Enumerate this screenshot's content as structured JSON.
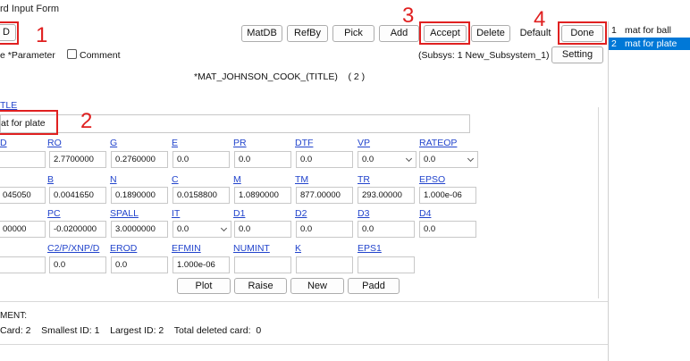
{
  "window": {
    "title": "rd Input Form"
  },
  "toolbar": {
    "id_button": "D",
    "matdb": "MatDB",
    "refby": "RefBy",
    "pick": "Pick",
    "add": "Add",
    "accept": "Accept",
    "delete": "Delete",
    "default": "Default",
    "done": "Done",
    "setting": "Setting"
  },
  "options": {
    "parameter_label": "e *Parameter",
    "comment_label": "Comment",
    "subsys": "(Subsys: 1 New_Subsystem_1)"
  },
  "keyword_title": "*MAT_JOHNSON_COOK_(TITLE)    ( 2 )",
  "title_field": {
    "label": "TLE",
    "value": "at for plate"
  },
  "annotations": [
    "1",
    "2",
    "3",
    "4"
  ],
  "rows": [
    {
      "labels": [
        "D",
        "RO",
        "G",
        "E",
        "PR",
        "DTF",
        "VP",
        "RATEOP"
      ],
      "values": [
        "",
        "2.7700000",
        "0.2760000",
        "0.0",
        "0.0",
        "0.0",
        "0.0",
        "0.0"
      ]
    },
    {
      "labels": [
        "",
        "B",
        "N",
        "C",
        "M",
        "TM",
        "TR",
        "EPSO"
      ],
      "values": [
        "045050",
        "0.0041650",
        "0.1890000",
        "0.0158800",
        "1.0890000",
        "877.00000",
        "293.00000",
        "1.000e-06"
      ]
    },
    {
      "labels": [
        "",
        "PC",
        "SPALL",
        "IT",
        "D1",
        "D2",
        "D3",
        "D4"
      ],
      "values": [
        "00000",
        "-0.0200000",
        "3.0000000",
        "0.0",
        "0.0",
        "0.0",
        "0.0",
        "0.0"
      ]
    },
    {
      "labels": [
        "",
        "C2/P/XNP/D",
        "EROD",
        "EFMIN",
        "NUMINT",
        "K",
        "EPS1"
      ],
      "values": [
        "",
        "0.0",
        "0.0",
        "1.000e-06",
        "",
        "",
        ""
      ]
    }
  ],
  "actions": {
    "plot": "Plot",
    "raise": "Raise",
    "new": "New",
    "padd": "Padd"
  },
  "comment_header": "MENT:",
  "status": "Card: 2    Smallest ID: 1    Largest ID: 2    Total deleted card:  0",
  "side_list": [
    {
      "num": "1",
      "name": "mat for ball"
    },
    {
      "num": "2",
      "name": "mat for plate"
    }
  ],
  "colors": {
    "accent_red": "#e02020",
    "link_blue": "#2244cc",
    "selection_blue": "#0078d7"
  }
}
